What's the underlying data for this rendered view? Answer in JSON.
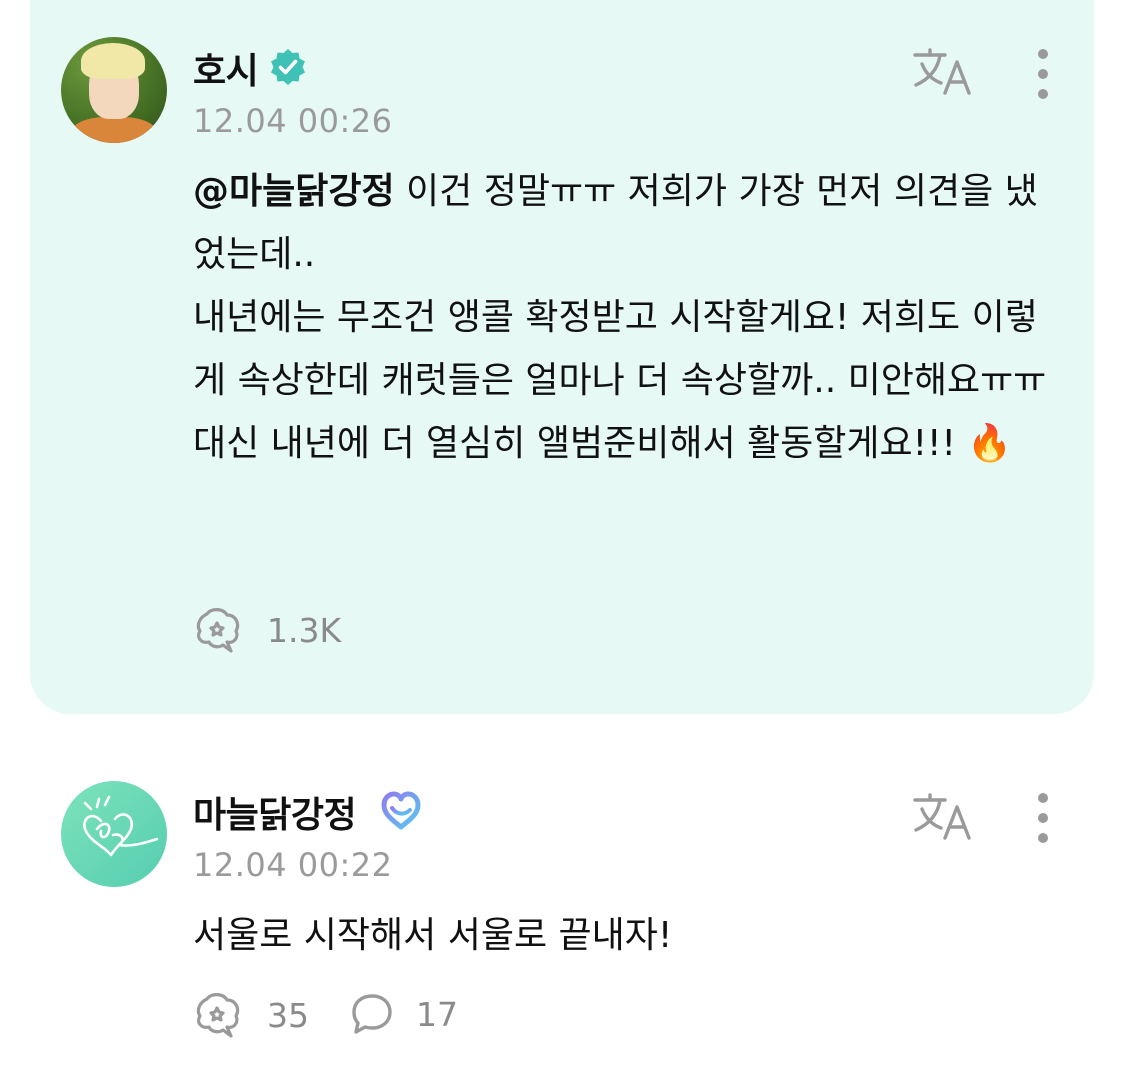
{
  "post": {
    "author": "호시",
    "verified_icon": "check-badge-icon",
    "time": "12.04 00:26",
    "mention": "@마늘닭강정",
    "body_after_mention": " 이건 정말ㅠㅠ 저희가 가장 먼저 의견을 냈었는데..\n내년에는 무조건 앵콜 확정받고 시작할게요! 저희도 이렇게 속상한데 캐럿들은 얼마나 더 속상할까.. 미안해요ㅠㅠ\n대신 내년에 더 열심히 앨범준비해서 활동할게요!!! ",
    "emoji": "🔥",
    "likes": "1.3K",
    "background": "#e7f9f5"
  },
  "reply": {
    "author": "마늘닭강정",
    "badge_icon": "heart-membership-icon",
    "time": "12.04 00:22",
    "body": "서울로 시작해서 서울로 끝내자!",
    "likes": "35",
    "comments": "17"
  },
  "colors": {
    "muted": "#9a9a9a",
    "verified": "#3fc2b5",
    "badge_gradient_start": "#8f7df0",
    "badge_gradient_end": "#58c8f0"
  }
}
